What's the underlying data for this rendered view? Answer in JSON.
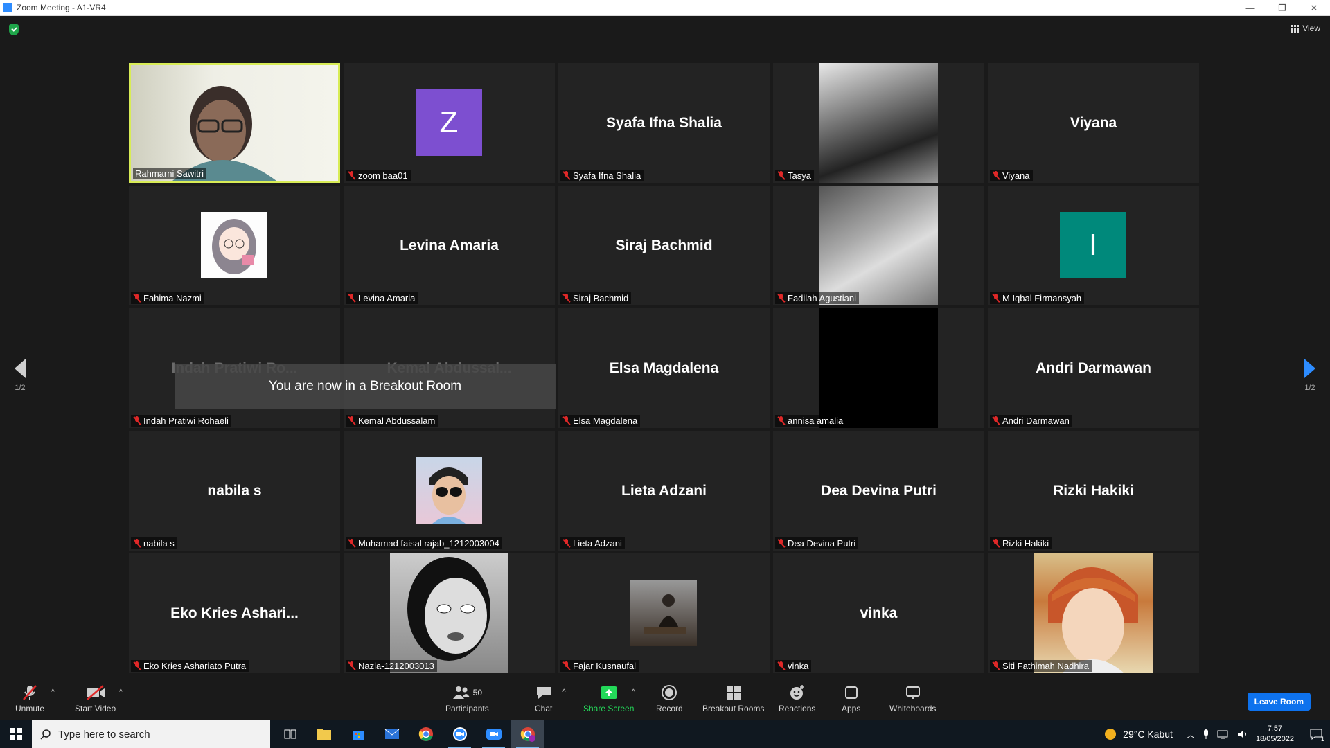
{
  "window": {
    "title": "Zoom Meeting - A1-VR4",
    "minimize": "—",
    "restore": "❐",
    "close": "✕"
  },
  "top_bar": {
    "view_label": "View"
  },
  "tiles": [
    {
      "name": "Rahmarni Sawitri",
      "display": "",
      "kind": "video",
      "active": true
    },
    {
      "name": "zoom baa01",
      "display": "Z",
      "kind": "avatar",
      "color": "#7d4fd0"
    },
    {
      "name": "Syafa Ifna Shalia",
      "display": "Syafa Ifna Shalia",
      "kind": "text"
    },
    {
      "name": "Tasya",
      "display": "",
      "kind": "photo"
    },
    {
      "name": "Viyana",
      "display": "Viyana",
      "kind": "text"
    },
    {
      "name": "Fahima Nazmi",
      "display": "",
      "kind": "photo-sq"
    },
    {
      "name": "Levina Amaria",
      "display": "Levina Amaria",
      "kind": "text"
    },
    {
      "name": "Siraj Bachmid",
      "display": "Siraj Bachmid",
      "kind": "text"
    },
    {
      "name": "Fadilah Agustiani",
      "display": "",
      "kind": "photo"
    },
    {
      "name": "M Iqbal Firmansyah",
      "display": "I",
      "kind": "avatar",
      "color": "#00897b"
    },
    {
      "name": "Indah Pratiwi Rohaeli",
      "display": "Indah Pratiwi Ro...",
      "kind": "text-dim"
    },
    {
      "name": "Kemal Abdussalam",
      "display": "Kemal Abdussal...",
      "kind": "text-dim"
    },
    {
      "name": "Elsa Magdalena",
      "display": "Elsa Magdalena",
      "kind": "text"
    },
    {
      "name": "annisa amalia",
      "display": "",
      "kind": "black"
    },
    {
      "name": "Andri Darmawan",
      "display": "Andri Darmawan",
      "kind": "text"
    },
    {
      "name": "nabila s",
      "display": "nabila s",
      "kind": "text"
    },
    {
      "name": "Muhamad faisal rajab_1212003004",
      "display": "",
      "kind": "photo-sq"
    },
    {
      "name": "Lieta Adzani",
      "display": "Lieta Adzani",
      "kind": "text"
    },
    {
      "name": "Dea Devina Putri",
      "display": "Dea Devina Putri",
      "kind": "text"
    },
    {
      "name": "Rizki Hakiki",
      "display": "Rizki Hakiki",
      "kind": "text"
    },
    {
      "name": "Eko Kries Ashariato Putra",
      "display": "Eko Kries Ashari...",
      "kind": "text"
    },
    {
      "name": "Nazla-1212003013",
      "display": "",
      "kind": "photo"
    },
    {
      "name": "Fajar Kusnaufal",
      "display": "",
      "kind": "photo-sq"
    },
    {
      "name": "vinka",
      "display": "vinka",
      "kind": "text"
    },
    {
      "name": "Siti Fathimah Nadhira",
      "display": "",
      "kind": "photo"
    }
  ],
  "breakout_message": "You are now in a Breakout Room",
  "pager": {
    "left": "1/2",
    "right": "1/2"
  },
  "toolbar": {
    "unmute": "Unmute",
    "start_video": "Start Video",
    "participants": "Participants",
    "participants_count": "50",
    "chat": "Chat",
    "share_screen": "Share Screen",
    "record": "Record",
    "breakout_rooms": "Breakout Rooms",
    "reactions": "Reactions",
    "apps": "Apps",
    "whiteboards": "Whiteboards",
    "leave": "Leave Room"
  },
  "taskbar": {
    "search_placeholder": "Type here to search",
    "weather": "29°C  Kabut",
    "time": "7:57",
    "date": "18/05/2022",
    "notifications": "1"
  },
  "colors": {
    "accent": "#2d8cff",
    "active_speaker": "#d8ec56",
    "share_green": "#23d959",
    "leave_blue": "#0e72ed"
  }
}
